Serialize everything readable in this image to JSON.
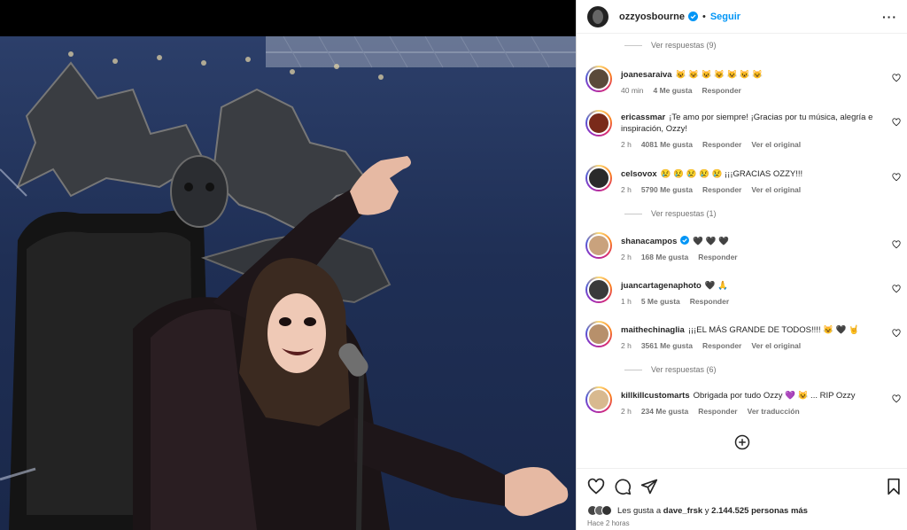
{
  "post": {
    "author": "ozzyosbourne",
    "follow_label": "Seguir",
    "separator": "•",
    "more_label": "···"
  },
  "comments": [
    {
      "type": "replies",
      "label": "Ver respuestas (9)"
    },
    {
      "user": "joanesaraiva",
      "text": "😺 😺 😺 😺 😺 😺 😺",
      "time": "40 min",
      "likes": "4 Me gusta",
      "reply": "Responder",
      "extra": ""
    },
    {
      "user": "ericassmar",
      "text": "¡Te amo por siempre! ¡Gracias por tu música, alegría e inspiración, Ozzy!",
      "time": "2 h",
      "likes": "4081 Me gusta",
      "reply": "Responder",
      "extra": "Ver el original"
    },
    {
      "user": "celsovox",
      "text": "😢 😢 😢 😢 😢 ¡¡¡GRACIAS OZZY!!!",
      "time": "2 h",
      "likes": "5790 Me gusta",
      "reply": "Responder",
      "extra": "Ver el original"
    },
    {
      "type": "replies",
      "label": "Ver respuestas (1)"
    },
    {
      "user": "shanacampos",
      "text": "🖤 🖤 🖤",
      "time": "2 h",
      "likes": "168 Me gusta",
      "reply": "Responder",
      "extra": "",
      "verified": true
    },
    {
      "user": "juancartagenaphoto",
      "text": "🖤 🙏",
      "time": "1 h",
      "likes": "5 Me gusta",
      "reply": "Responder",
      "extra": ""
    },
    {
      "user": "maithechinaglia",
      "text": "¡¡¡EL MÁS GRANDE DE TODOS!!!! 😺 🖤 🤘",
      "time": "2 h",
      "likes": "3561 Me gusta",
      "reply": "Responder",
      "extra": "Ver el original"
    },
    {
      "type": "replies",
      "label": "Ver respuestas (6)"
    },
    {
      "user": "killkillcustomarts",
      "text": "Obrigada por tudo Ozzy 💜 😺 ... RIP Ozzy",
      "time": "2 h",
      "likes": "234 Me gusta",
      "reply": "Responder",
      "extra": "Ver traducción"
    }
  ],
  "likes_summary": {
    "prefix": "Les gusta a",
    "first_user": "dave_frsk",
    "joiner": "y",
    "count": "2.144.525 personas más"
  },
  "posted_ago": "Hace 2 horas",
  "colors": {
    "accent": "#0095f6",
    "text": "#262626",
    "muted": "#737373"
  }
}
